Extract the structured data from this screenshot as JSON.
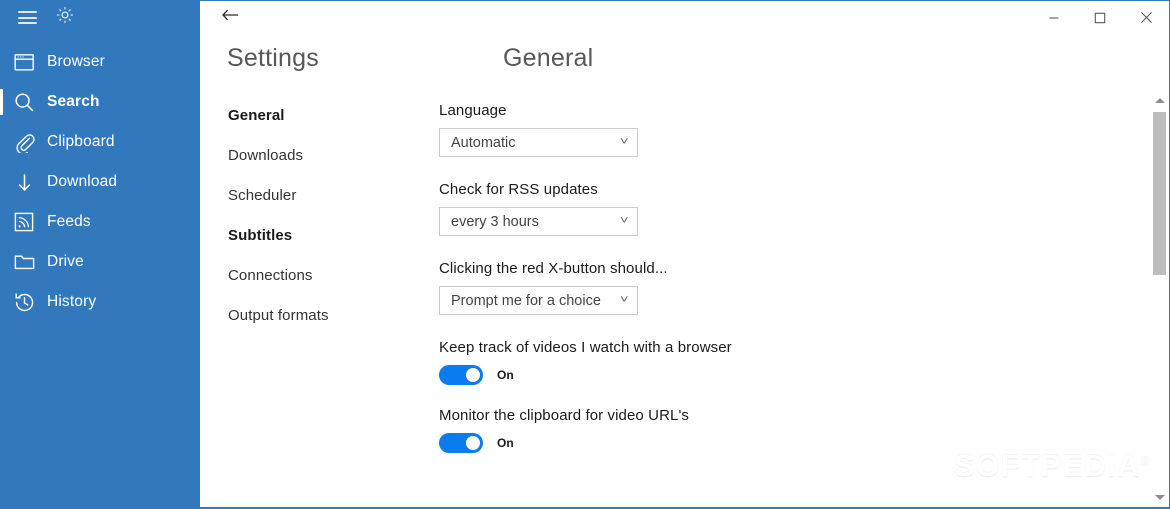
{
  "theme": {
    "sidebar_bg": "#3179bc",
    "accent": "#0a7cf0",
    "window_border": "#3179bc",
    "text_dark": "#1b1b1b",
    "text_muted": "#585858"
  },
  "sidebar": {
    "menu_icon": "hamburger-icon",
    "settings_icon": "gear-icon",
    "items": [
      {
        "label": "Browser",
        "icon": "browser-window-icon",
        "active": false
      },
      {
        "label": "Search",
        "icon": "magnifier-icon",
        "active": true
      },
      {
        "label": "Clipboard",
        "icon": "paperclip-icon",
        "active": false
      },
      {
        "label": "Download",
        "icon": "download-arrow-icon",
        "active": false
      },
      {
        "label": "Feeds",
        "icon": "rss-icon",
        "active": false
      },
      {
        "label": "Drive",
        "icon": "folder-icon",
        "active": false
      },
      {
        "label": "History",
        "icon": "clock-history-icon",
        "active": false
      }
    ]
  },
  "titlebar": {
    "back_icon": "back-arrow-icon",
    "minimize_label": "–",
    "maximize_label": "□",
    "close_label": "✕"
  },
  "settings": {
    "title": "Settings",
    "page_heading": "General",
    "nav": [
      {
        "label": "General",
        "bold": true
      },
      {
        "label": "Downloads",
        "bold": false
      },
      {
        "label": "Scheduler",
        "bold": false
      },
      {
        "label": "Subtitles",
        "bold": true
      },
      {
        "label": "Connections",
        "bold": false
      },
      {
        "label": "Output formats",
        "bold": false
      }
    ],
    "fields": [
      {
        "label": "Language",
        "value": "Automatic"
      },
      {
        "label": "Check for RSS updates",
        "value": "every 3 hours"
      },
      {
        "label": "Clicking the red X-button should...",
        "value": "Prompt me for a choice"
      }
    ],
    "toggles": [
      {
        "label": "Keep track of videos I watch with a browser",
        "state": "On",
        "on": true
      },
      {
        "label": "Monitor the clipboard for video URL's",
        "state": "On",
        "on": true
      }
    ]
  },
  "scrollbar": {
    "up_arrow": "scroll-up-arrow-icon",
    "down_arrow": "scroll-down-arrow-icon"
  },
  "watermark": {
    "text": "SOFTPEDIA",
    "mark": "®"
  }
}
